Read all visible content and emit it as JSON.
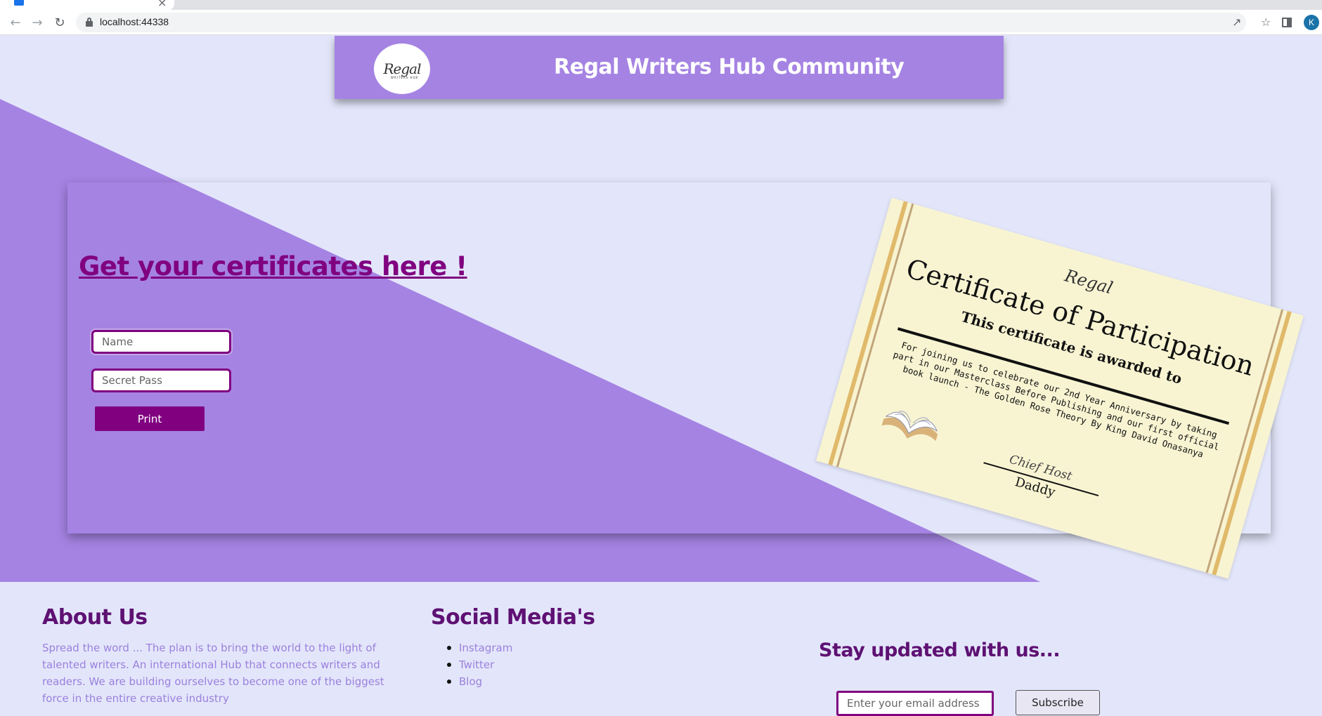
{
  "browser": {
    "url": "localhost:44338",
    "profile_initial": "K",
    "tab_close": "×"
  },
  "header": {
    "logo_text": "Regal",
    "logo_sub": "WRITERS HUB",
    "title": "Regal Writers Hub Community"
  },
  "form": {
    "heading": "Get your certificates here !",
    "name_placeholder": "Name",
    "pass_placeholder": "Secret Pass",
    "print_label": "Print"
  },
  "certificate": {
    "logo_text": "Regal",
    "title": "Certificate of Participation",
    "subtitle": "This certificate is awarded to",
    "body": "For joining us to celebrate our 2nd Year Anniversary by taking part in our Masterclass Before Publishing and our first official book launch - The Golden Rose Theory By King David Onasanya",
    "signature_label": "Chief Host",
    "signature_name": "Daddy"
  },
  "footer": {
    "about_title": "About Us",
    "about_text": "Spread the word ... The plan is to bring the world to the light of talented writers. An international Hub that connects writers and readers. We are building ourselves to become one of the biggest force in the entire creative industry",
    "social_title": "Social Media's",
    "social_links": [
      "Instagram",
      "Twitter",
      "Blog"
    ],
    "stay_title": "Stay updated with us...",
    "email_placeholder": "Enter your email address",
    "subscribe_label": "Subscribe"
  },
  "colors": {
    "purple_bg": "#a583e3",
    "accent": "#800080",
    "page_bg": "#e3e6fa"
  }
}
